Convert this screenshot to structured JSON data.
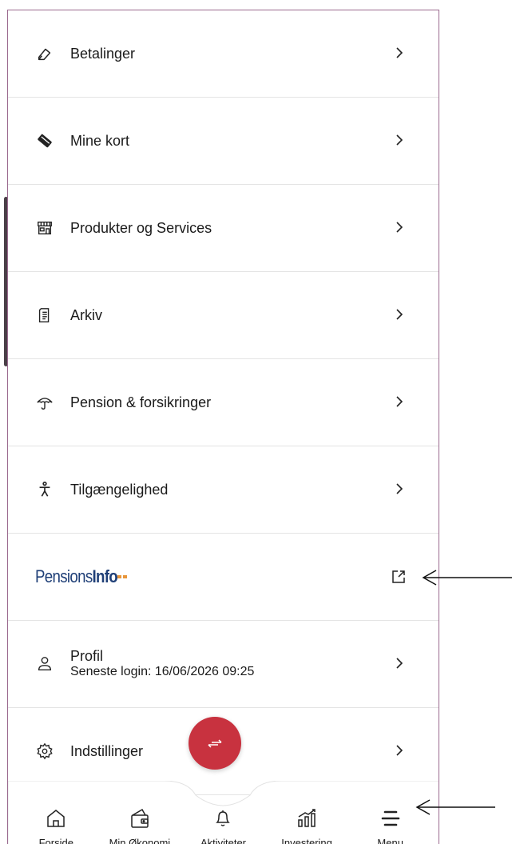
{
  "menu": {
    "items": [
      {
        "label": "Betalinger",
        "icon": "pen-icon"
      },
      {
        "label": "Mine kort",
        "icon": "card-icon"
      },
      {
        "label": "Produkter og Services",
        "icon": "store-icon"
      },
      {
        "label": "Arkiv",
        "icon": "document-icon"
      },
      {
        "label": "Pension & forsikringer",
        "icon": "umbrella-icon"
      },
      {
        "label": "Tilgængelighed",
        "icon": "accessibility-icon"
      }
    ],
    "pensionsinfo": {
      "logo_light": "Pensions",
      "logo_bold": "Info"
    },
    "profile": {
      "label": "Profil",
      "last_login": "Seneste login: 16/06/2026 09:25"
    },
    "settings": {
      "label": "Indstillinger"
    }
  },
  "bottom_nav": {
    "items": [
      {
        "label": "Forside",
        "icon": "home-icon"
      },
      {
        "label": "Min Økonomi",
        "icon": "wallet-icon"
      },
      {
        "label": "Aktiviteter",
        "icon": "bell-icon"
      },
      {
        "label": "Investering",
        "icon": "chart-icon"
      },
      {
        "label": "Menu",
        "icon": "menu-icon"
      }
    ],
    "fab_icon": "transfer-icon"
  },
  "colors": {
    "accent": "#c8323f",
    "logo_blue": "#1f3f77",
    "logo_orange": "#e8963b"
  }
}
